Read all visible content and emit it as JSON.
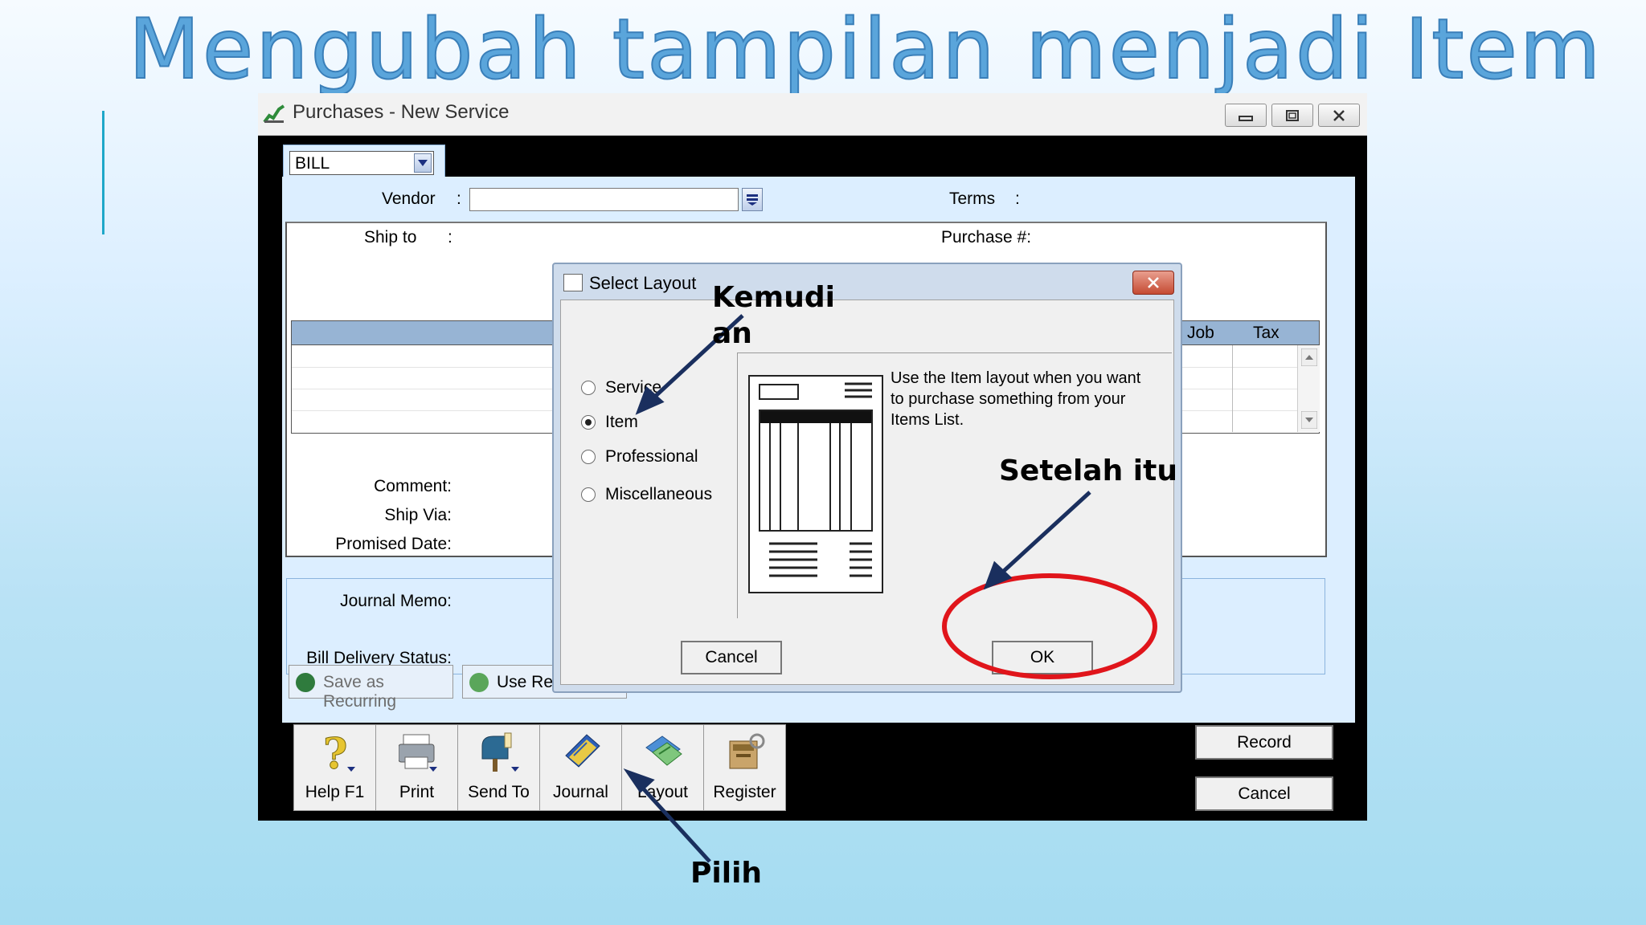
{
  "slide": {
    "title": "Mengubah tampilan menjadi Item"
  },
  "window": {
    "title": "Purchases - New Service",
    "controls": [
      "minimize",
      "maximize",
      "close"
    ]
  },
  "form": {
    "bill_type": "BILL",
    "vendor_label": "Vendor",
    "vendor_value": "",
    "terms_label": "Terms",
    "ship_to_label": "Ship to",
    "purchase_no_label": "Purchase #:",
    "colon": ":",
    "columns": {
      "job": "Job",
      "tax": "Tax"
    },
    "comment_label": "Comment:",
    "ship_via_label": "Ship Via:",
    "promised_date_label": "Promised Date:",
    "journal_memo_label": "Journal Memo:",
    "bill_delivery_label": "Bill Delivery Status:",
    "save_recurring": "Save as Recurring",
    "use_recurring": "Use Recurring"
  },
  "toolbar": {
    "items": [
      {
        "label": "Help F1",
        "icon": "help-icon"
      },
      {
        "label": "Print",
        "icon": "printer-icon"
      },
      {
        "label": "Send To",
        "icon": "mailbox-icon"
      },
      {
        "label": "Journal",
        "icon": "journal-icon"
      },
      {
        "label": "Layout",
        "icon": "layout-icon"
      },
      {
        "label": "Register",
        "icon": "register-icon"
      }
    ],
    "record": "Record",
    "cancel": "Cancel"
  },
  "dialog": {
    "title": "Select Layout",
    "options": [
      {
        "label": "Service",
        "selected": false
      },
      {
        "label": "Item",
        "selected": true
      },
      {
        "label": "Professional",
        "selected": false
      },
      {
        "label": "Miscellaneous",
        "selected": false
      }
    ],
    "description": "Use the Item layout when you want to purchase something from your Items List.",
    "cancel": "Cancel",
    "ok": "OK"
  },
  "annotations": {
    "step1": "Pilih",
    "step2_line1": "Kemudi",
    "step2_line2": "an",
    "step3": "Setelah itu",
    "arrow_color": "#1a2f5e",
    "highlight_color": "#e0151b"
  }
}
